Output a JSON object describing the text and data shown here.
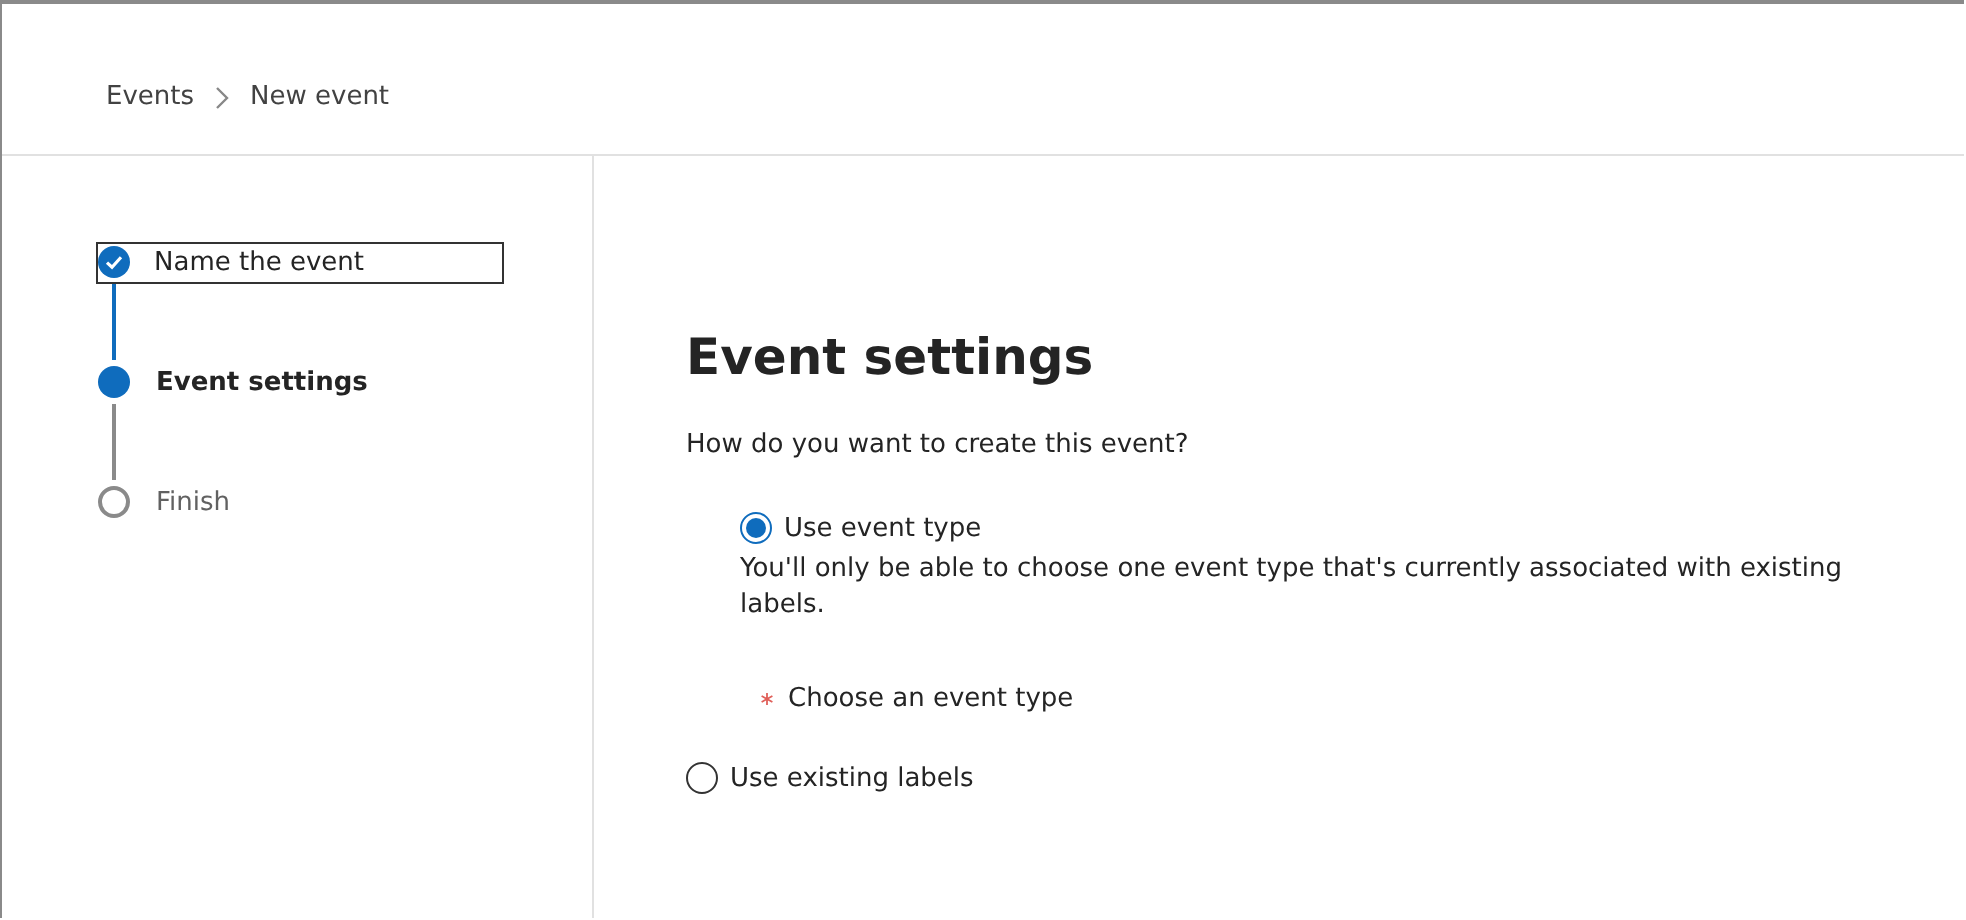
{
  "breadcrumb": [
    {
      "label": "Events"
    },
    {
      "label": "New event"
    }
  ],
  "steps": [
    {
      "label": "Name the event",
      "kind": "done",
      "focused": true
    },
    {
      "label": "Event settings",
      "kind": "current",
      "focused": false
    },
    {
      "label": "Finish",
      "kind": "pending",
      "focused": false
    }
  ],
  "heading": "Event settings",
  "question": "How do you want to create this event?",
  "options": [
    {
      "label": "Use event type",
      "selected": true,
      "description": "You'll only be able to choose one event type that's currently associated with existing labels.",
      "field": {
        "label": "Choose an event type",
        "required": true
      }
    },
    {
      "label": "Use existing labels",
      "selected": false
    }
  ]
}
